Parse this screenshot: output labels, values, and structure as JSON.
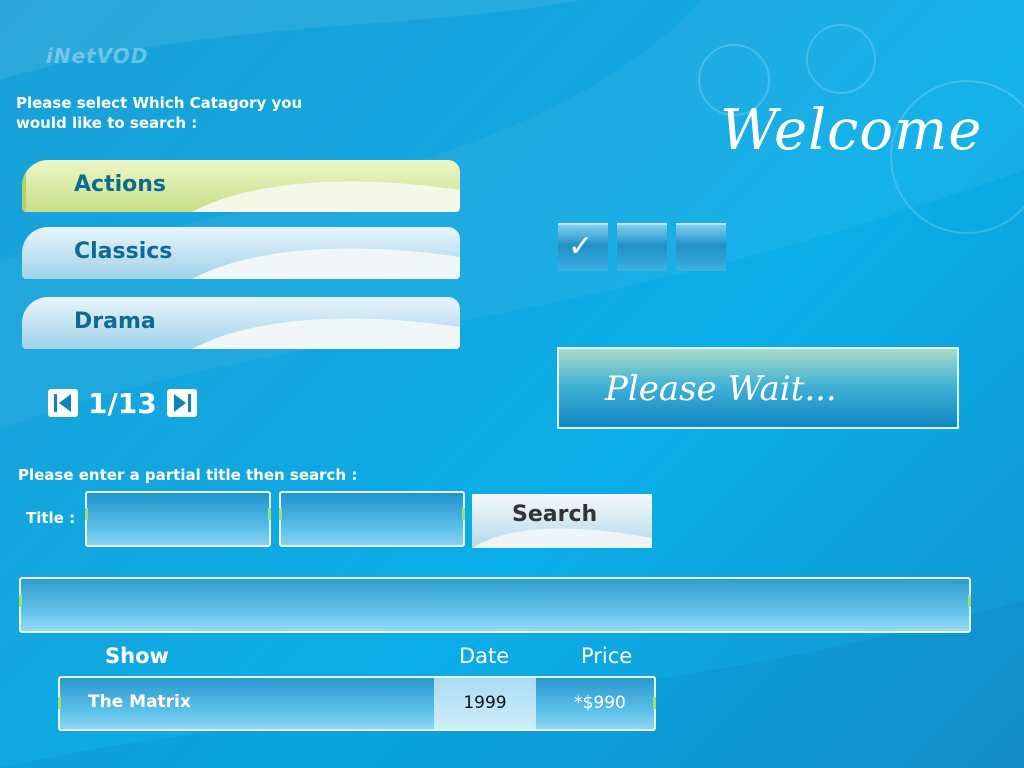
{
  "app": {
    "logo_text": "iNetVOD"
  },
  "category_panel": {
    "prompt": "Please select Which Catagory you would like to search :",
    "items": [
      {
        "label": "Actions",
        "selected": true
      },
      {
        "label": "Classics",
        "selected": false
      },
      {
        "label": "Drama",
        "selected": false
      }
    ],
    "pager": {
      "text": "1/13",
      "prev_icon": "prev-page-icon",
      "next_icon": "next-page-icon"
    }
  },
  "welcome": {
    "title": "Welcome"
  },
  "checkboxes": [
    {
      "checked": true
    },
    {
      "checked": false
    },
    {
      "checked": false
    }
  ],
  "status": {
    "message": "Please Wait..."
  },
  "search": {
    "prompt": "Please enter a partial title then search :",
    "title_label": "Title :",
    "field1_value": "",
    "field2_value": "",
    "button_label": "Search"
  },
  "results": {
    "bar_value": "",
    "columns": {
      "show": "Show",
      "date": "Date",
      "price": "Price"
    },
    "rows": [
      {
        "show": "The Matrix",
        "date": "1999",
        "price": "*$990"
      }
    ]
  },
  "colors": {
    "background": "#12a7e0",
    "category_label": "#0e6b8f",
    "selected_button": "#dfeab0",
    "checkbox_tick": "#ffffff"
  }
}
